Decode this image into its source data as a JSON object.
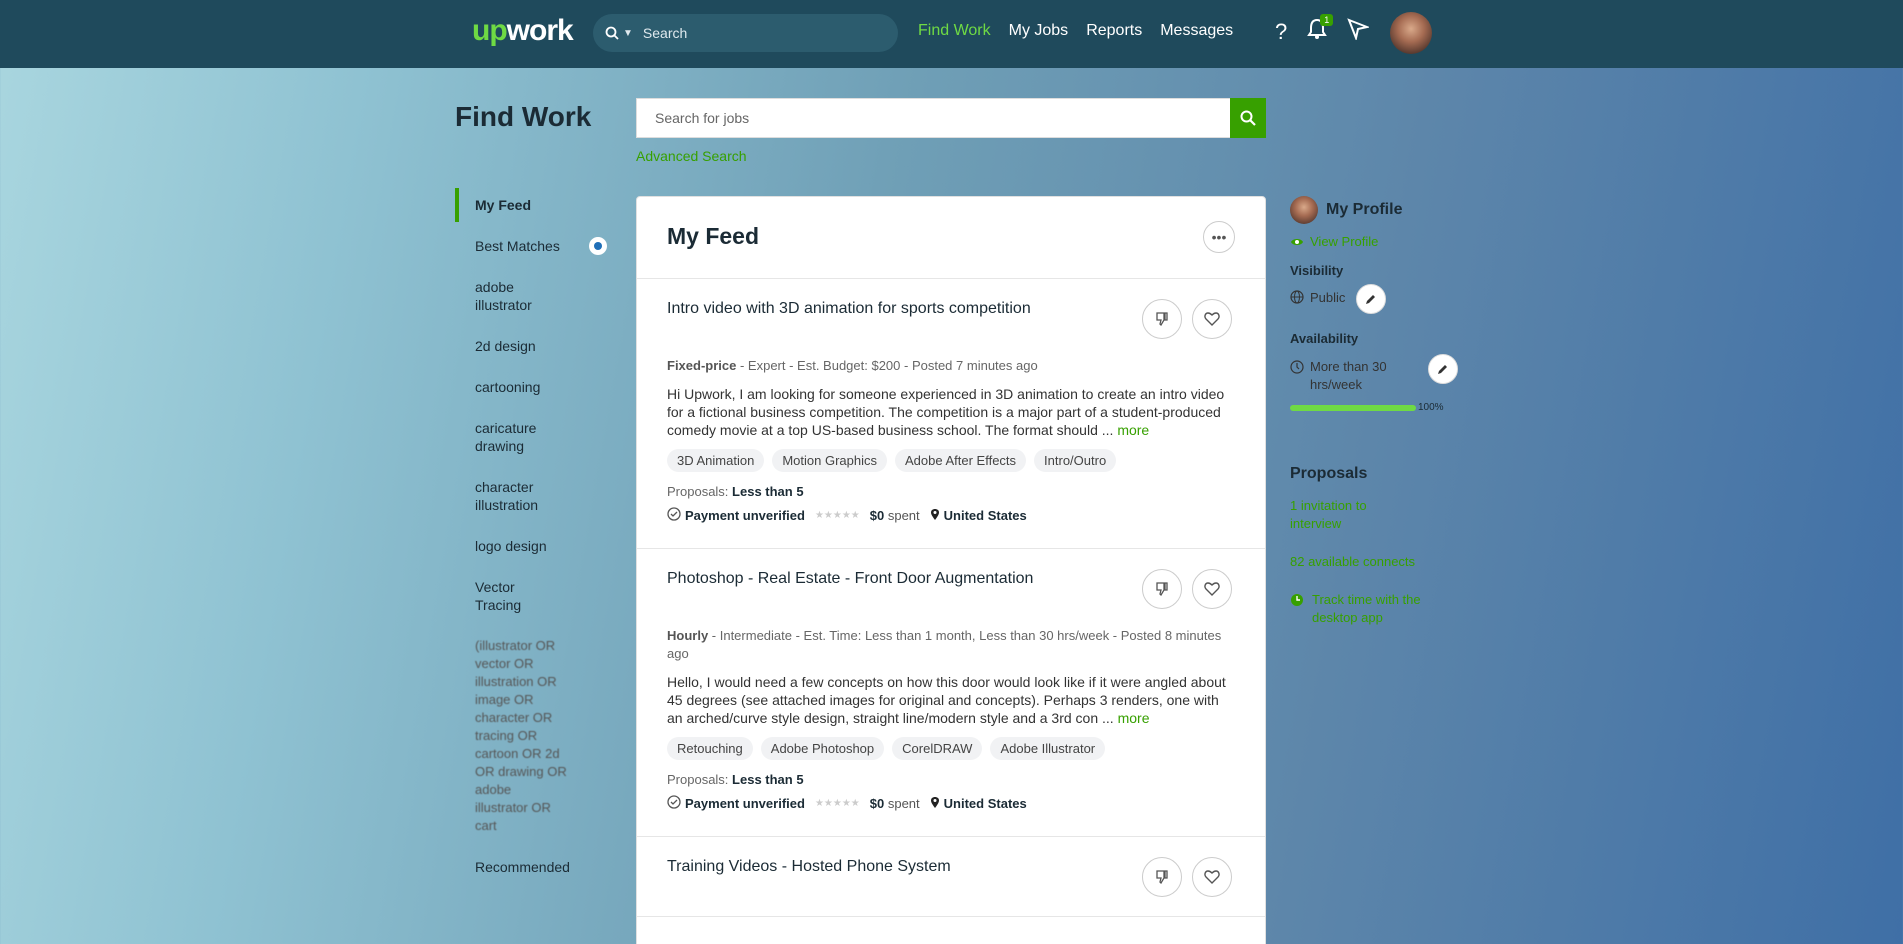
{
  "topbar": {
    "logo_up": "up",
    "logo_work": "work",
    "search_placeholder": "Search",
    "nav": [
      "Find Work",
      "My Jobs",
      "Reports",
      "Messages"
    ],
    "notification_count": "1"
  },
  "page": {
    "title": "Find Work",
    "search_placeholder": "Search for jobs",
    "advanced_search": "Advanced Search"
  },
  "sidebar": {
    "items": [
      "My Feed",
      "Best Matches",
      "adobe illustrator",
      "2d design",
      "cartooning",
      "caricature drawing",
      "character illustration",
      "logo design",
      "Vector Tracing",
      "(illustrator OR vector OR illustration OR image OR character OR tracing OR cartoon OR 2d OR drawing OR adobe illustrator OR cart",
      "Recommended"
    ]
  },
  "feed": {
    "title": "My Feed",
    "jobs": [
      {
        "title": "Intro video with 3D animation for sports competition",
        "type": "Fixed-price",
        "meta": " - Expert - Est. Budget: $200 - Posted 7 minutes ago",
        "description": "Hi Upwork, I am looking for someone experienced in 3D animation to create an intro video for a fictional business competition. The competition is a major part of a student-produced comedy movie at a top US-based business school. The format should ... ",
        "more": "more",
        "tags": [
          "3D Animation",
          "Motion Graphics",
          "Adobe After Effects",
          "Intro/Outro"
        ],
        "proposals_label": "Proposals: ",
        "proposals_value": "Less than 5",
        "payment": "Payment unverified",
        "spent_amount": "$0",
        "spent_label": " spent",
        "location": "United States"
      },
      {
        "title": "Photoshop - Real Estate - Front Door Augmentation",
        "type": "Hourly",
        "meta": " - Intermediate - Est. Time: Less than 1 month, Less than 30 hrs/week - Posted 8 minutes ago",
        "description": "Hello, I would need a few concepts on how this door would look like if it were angled about 45 degrees (see attached images for original and concepts). Perhaps 3 renders, one with an arched/curve style design, straight line/modern style and a 3rd con ... ",
        "more": "more",
        "tags": [
          "Retouching",
          "Adobe Photoshop",
          "CorelDRAW",
          "Adobe Illustrator"
        ],
        "proposals_label": "Proposals: ",
        "proposals_value": "Less than 5",
        "payment": "Payment unverified",
        "spent_amount": "$0",
        "spent_label": " spent",
        "location": "United States"
      },
      {
        "title": "Training Videos - Hosted Phone System"
      }
    ]
  },
  "profile": {
    "title": "My Profile",
    "view_profile": "View Profile",
    "visibility_label": "Visibility",
    "visibility_value": "Public",
    "availability_label": "Availability",
    "availability_value": "More than 30 hrs/week",
    "completeness": 1.0,
    "completeness_text": "100%",
    "proposals_label": "Proposals",
    "invitations": "1 invitation to interview",
    "connects": "82 available connects",
    "track_time": "Track time with the desktop app"
  },
  "colors": {
    "brand_green": "#37a000",
    "accent_green": "#6fda44",
    "topbar": "#1f4a5c"
  }
}
